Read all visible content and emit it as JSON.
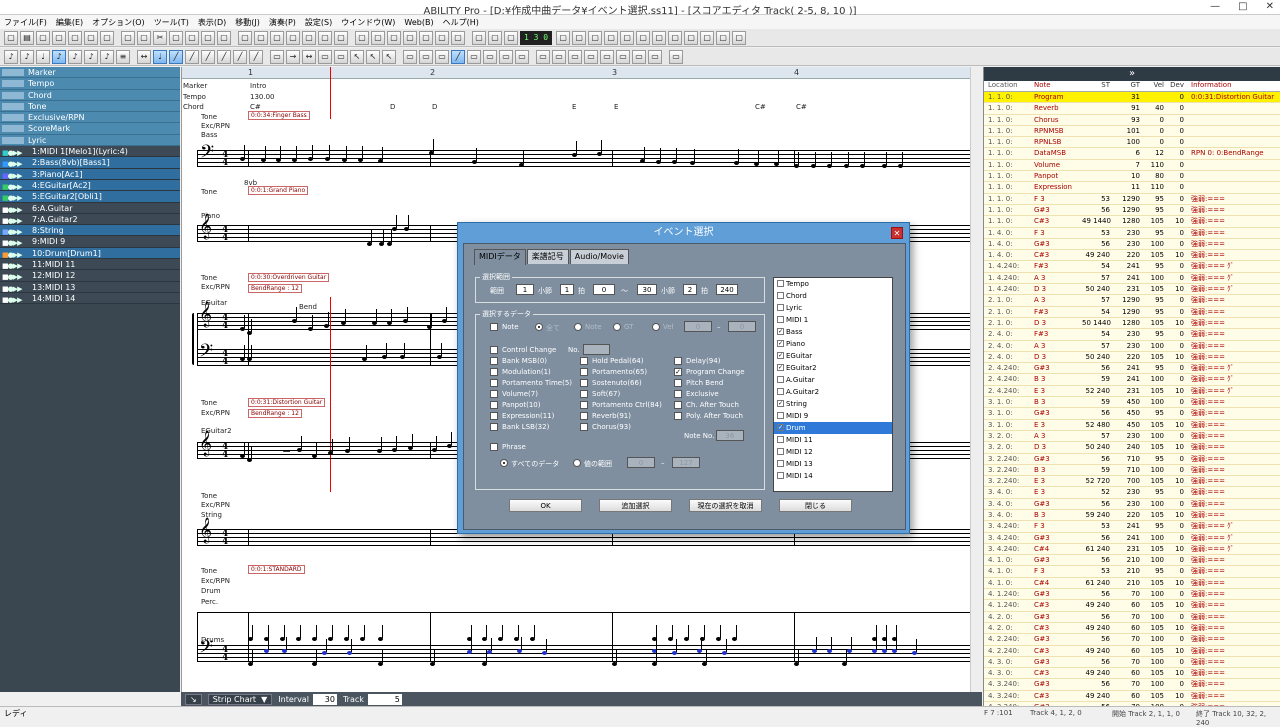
{
  "window": {
    "title": "ABILITY Pro - [D:¥作成中曲データ¥イベント選択.ss11] - [スコアエディタ Track( 2-5, 8, 10 )]",
    "minimize": "—",
    "maximize": "□",
    "close": "✕"
  },
  "menu": [
    "ファイル(F)",
    "編集(E)",
    "オプション(O)",
    "ツール(T)",
    "表示(D)",
    "移動(J)",
    "演奏(P)",
    "設定(S)",
    "ウインドウ(W)",
    "Web(B)",
    "ヘルプ(H)"
  ],
  "toolbar": {
    "counter": "1 3 0"
  },
  "tracks": {
    "master": [
      "Marker",
      "Tempo",
      "Chord",
      "Tone",
      "Exclusive/RPN",
      "ScoreMark",
      "Lyric"
    ],
    "items": [
      {
        "label": "1:MIDI 1[Melo1](Lyric:4)",
        "sel": false
      },
      {
        "label": "2:Bass(8vb)[Bass1]",
        "sel": true
      },
      {
        "label": "3:Piano[Ac1]",
        "sel": true
      },
      {
        "label": "4:EGuitar[Ac2]",
        "sel": true
      },
      {
        "label": "5:EGuitar2[Obli1]",
        "sel": true
      },
      {
        "label": "6:A.Guitar",
        "sel": false
      },
      {
        "label": "7:A.Guitar2",
        "sel": false
      },
      {
        "label": "8:String",
        "sel": true
      },
      {
        "label": "9:MIDI 9",
        "sel": false
      },
      {
        "label": "10:Drum[Drum1]",
        "sel": true
      },
      {
        "label": "11:MIDI 11",
        "sel": false
      },
      {
        "label": "12:MIDI 12",
        "sel": false
      },
      {
        "label": "13:MIDI 13",
        "sel": false
      },
      {
        "label": "14:MIDI 14",
        "sel": false
      }
    ]
  },
  "score": {
    "ruler": [
      "1",
      "2",
      "3",
      "4"
    ],
    "header": {
      "marker": "Marker",
      "marker_val": "Intro",
      "tempo": "Tempo",
      "tempo_val": "130.00",
      "chord": "Chord",
      "chords": [
        "C#",
        "D",
        "D",
        "E",
        "E",
        "C#",
        "C#"
      ]
    },
    "labels": {
      "tone": "Tone",
      "exc": "Exc/RPN",
      "bass": "Bass",
      "piano": "Piano",
      "eguitar": "EGuitar",
      "eguitar2": "EGuitar2",
      "string": "String",
      "drum": "Drum",
      "perc": "Perc.",
      "drums": "Drums",
      "oct": "8vb",
      "bendlbl": "Bend"
    },
    "tones": {
      "bass": "0:0:34:Finger Bass",
      "piano": "0:0:1:Grand Piano",
      "eg": "0:0:30:Overdriven Guitar",
      "eg_bend": "BendRange : 12",
      "eg2": "0:0:31:Distortion Guitar",
      "eg2_bend": "BendRange : 12",
      "drum": "0:0:1:STANDARD"
    }
  },
  "bottombar": {
    "mode": "Strip Chart",
    "interval_label": "Interval",
    "interval": "30",
    "track_label": "Track",
    "track": "5"
  },
  "statusbar": {
    "ready": "レディ",
    "r1": "F 7 :101",
    "r2": "Track 4, 1, 2, 0",
    "r3": "開始 Track 2, 1, 1, 0",
    "r4": "終了 Track 10, 32, 2, 240"
  },
  "eventlist": {
    "header": "»",
    "cols": [
      "Location",
      "Note",
      "ST",
      "GT",
      "Vel",
      "Dev",
      "Information"
    ],
    "rows": [
      {
        "loc": "1. 1. 0:",
        "note": "Program",
        "st": "",
        "gt": "31",
        "vel": "",
        "dev": "0",
        "info": "0:0:31:Distortion Guitar",
        "hl": true
      },
      {
        "loc": "1. 1. 0:",
        "note": "Reverb",
        "st": "",
        "gt": "91",
        "vel": "40",
        "dev": "0",
        "info": ""
      },
      {
        "loc": "1. 1. 0:",
        "note": "Chorus",
        "st": "",
        "gt": "93",
        "vel": "0",
        "dev": "0",
        "info": ""
      },
      {
        "loc": "1. 1. 0:",
        "note": "RPNMSB",
        "st": "",
        "gt": "101",
        "vel": "0",
        "dev": "0",
        "info": ""
      },
      {
        "loc": "1. 1. 0:",
        "note": "RPNLSB",
        "st": "",
        "gt": "100",
        "vel": "0",
        "dev": "0",
        "info": ""
      },
      {
        "loc": "1. 1. 0:",
        "note": "DataMSB",
        "st": "",
        "gt": "6",
        "vel": "12",
        "dev": "0",
        "info": "RPN 0: 0:BendRange"
      },
      {
        "loc": "1. 1. 0:",
        "note": "Volume",
        "st": "",
        "gt": "7",
        "vel": "110",
        "dev": "0",
        "info": ""
      },
      {
        "loc": "1. 1. 0:",
        "note": "Panpot",
        "st": "",
        "gt": "10",
        "vel": "80",
        "dev": "0",
        "info": ""
      },
      {
        "loc": "1. 1. 0:",
        "note": "Expression",
        "st": "",
        "gt": "11",
        "vel": "110",
        "dev": "0",
        "info": ""
      },
      {
        "loc": "1. 1. 0:",
        "note": "F 3",
        "st": "53",
        "gt": "1290",
        "vel": "95",
        "dev": "0",
        "info": "強弱:==="
      },
      {
        "loc": "1. 1. 0:",
        "note": "G#3",
        "st": "56",
        "gt": "1290",
        "vel": "95",
        "dev": "0",
        "info": "強弱:==="
      },
      {
        "loc": "1. 1. 0:",
        "note": "C#3",
        "st": "49 1440",
        "gt": "1280",
        "vel": "105",
        "dev": "10",
        "info": "強弱:==="
      },
      {
        "loc": "1. 4. 0:",
        "note": "F 3",
        "st": "53",
        "gt": "230",
        "vel": "95",
        "dev": "0",
        "info": "強弱:==="
      },
      {
        "loc": "1. 4. 0:",
        "note": "G#3",
        "st": "56",
        "gt": "230",
        "vel": "100",
        "dev": "0",
        "info": "強弱:==="
      },
      {
        "loc": "1. 4. 0:",
        "note": "C#3",
        "st": "49 240",
        "gt": "220",
        "vel": "105",
        "dev": "10",
        "info": "強弱:==="
      },
      {
        "loc": "1. 4.240:",
        "note": "F#3",
        "st": "54",
        "gt": "241",
        "vel": "95",
        "dev": "0",
        "info": "強弱:=== ｸﾞ"
      },
      {
        "loc": "1. 4.240:",
        "note": "A 3",
        "st": "57",
        "gt": "241",
        "vel": "100",
        "dev": "0",
        "info": "強弱:=== ｸﾞ"
      },
      {
        "loc": "1. 4.240:",
        "note": "D 3",
        "st": "50 240",
        "gt": "231",
        "vel": "105",
        "dev": "10",
        "info": "強弱:=== ｸﾞ"
      },
      {
        "loc": "2. 1. 0:",
        "note": "A 3",
        "st": "57",
        "gt": "1290",
        "vel": "95",
        "dev": "0",
        "info": "強弱:==="
      },
      {
        "loc": "2. 1. 0:",
        "note": "F#3",
        "st": "54",
        "gt": "1290",
        "vel": "95",
        "dev": "0",
        "info": "強弱:==="
      },
      {
        "loc": "2. 1. 0:",
        "note": "D 3",
        "st": "50 1440",
        "gt": "1280",
        "vel": "105",
        "dev": "10",
        "info": "強弱:==="
      },
      {
        "loc": "2. 4. 0:",
        "note": "F#3",
        "st": "54",
        "gt": "230",
        "vel": "95",
        "dev": "0",
        "info": "強弱:==="
      },
      {
        "loc": "2. 4. 0:",
        "note": "A 3",
        "st": "57",
        "gt": "230",
        "vel": "100",
        "dev": "0",
        "info": "強弱:==="
      },
      {
        "loc": "2. 4. 0:",
        "note": "D 3",
        "st": "50 240",
        "gt": "220",
        "vel": "105",
        "dev": "10",
        "info": "強弱:==="
      },
      {
        "loc": "2. 4.240:",
        "note": "G#3",
        "st": "56",
        "gt": "241",
        "vel": "95",
        "dev": "0",
        "info": "強弱:=== ｸﾞ"
      },
      {
        "loc": "2. 4.240:",
        "note": "B 3",
        "st": "59",
        "gt": "241",
        "vel": "100",
        "dev": "0",
        "info": "強弱:=== ｸﾞ"
      },
      {
        "loc": "2. 4.240:",
        "note": "E 3",
        "st": "52 240",
        "gt": "231",
        "vel": "105",
        "dev": "10",
        "info": "強弱:=== ｸﾞ"
      },
      {
        "loc": "3. 1. 0:",
        "note": "B 3",
        "st": "59",
        "gt": "450",
        "vel": "100",
        "dev": "0",
        "info": "強弱:==="
      },
      {
        "loc": "3. 1. 0:",
        "note": "G#3",
        "st": "56",
        "gt": "450",
        "vel": "95",
        "dev": "0",
        "info": "強弱:==="
      },
      {
        "loc": "3. 1. 0:",
        "note": "E 3",
        "st": "52 480",
        "gt": "450",
        "vel": "105",
        "dev": "10",
        "info": "強弱:==="
      },
      {
        "loc": "3. 2. 0:",
        "note": "A 3",
        "st": "57",
        "gt": "230",
        "vel": "100",
        "dev": "0",
        "info": "強弱:==="
      },
      {
        "loc": "3. 2. 0:",
        "note": "D 3",
        "st": "50 240",
        "gt": "240",
        "vel": "105",
        "dev": "10",
        "info": "強弱:==="
      },
      {
        "loc": "3. 2.240:",
        "note": "G#3",
        "st": "56",
        "gt": "710",
        "vel": "95",
        "dev": "0",
        "info": "強弱:==="
      },
      {
        "loc": "3. 2.240:",
        "note": "B 3",
        "st": "59",
        "gt": "710",
        "vel": "100",
        "dev": "0",
        "info": "強弱:==="
      },
      {
        "loc": "3. 2.240:",
        "note": "E 3",
        "st": "52 720",
        "gt": "700",
        "vel": "105",
        "dev": "10",
        "info": "強弱:==="
      },
      {
        "loc": "3. 4. 0:",
        "note": "E 3",
        "st": "52",
        "gt": "230",
        "vel": "95",
        "dev": "0",
        "info": "強弱:==="
      },
      {
        "loc": "3. 4. 0:",
        "note": "G#3",
        "st": "56",
        "gt": "230",
        "vel": "100",
        "dev": "0",
        "info": "強弱:==="
      },
      {
        "loc": "3. 4. 0:",
        "note": "B 3",
        "st": "59 240",
        "gt": "220",
        "vel": "105",
        "dev": "10",
        "info": "強弱:==="
      },
      {
        "loc": "3. 4.240:",
        "note": "F 3",
        "st": "53",
        "gt": "241",
        "vel": "95",
        "dev": "0",
        "info": "強弱:=== ｸﾞ"
      },
      {
        "loc": "3. 4.240:",
        "note": "G#3",
        "st": "56",
        "gt": "241",
        "vel": "100",
        "dev": "0",
        "info": "強弱:=== ｸﾞ"
      },
      {
        "loc": "3. 4.240:",
        "note": "C#4",
        "st": "61 240",
        "gt": "231",
        "vel": "105",
        "dev": "10",
        "info": "強弱:=== ｸﾞ"
      },
      {
        "loc": "4. 1. 0:",
        "note": "G#3",
        "st": "56",
        "gt": "210",
        "vel": "100",
        "dev": "0",
        "info": "強弱:==="
      },
      {
        "loc": "4. 1. 0:",
        "note": "F 3",
        "st": "53",
        "gt": "210",
        "vel": "95",
        "dev": "0",
        "info": "強弱:==="
      },
      {
        "loc": "4. 1. 0:",
        "note": "C#4",
        "st": "61 240",
        "gt": "210",
        "vel": "105",
        "dev": "10",
        "info": "強弱:==="
      },
      {
        "loc": "4. 1.240:",
        "note": "G#3",
        "st": "56",
        "gt": "70",
        "vel": "100",
        "dev": "0",
        "info": "強弱:==="
      },
      {
        "loc": "4. 1.240:",
        "note": "C#3",
        "st": "49 240",
        "gt": "60",
        "vel": "105",
        "dev": "10",
        "info": "強弱:==="
      },
      {
        "loc": "4. 2. 0:",
        "note": "G#3",
        "st": "56",
        "gt": "70",
        "vel": "100",
        "dev": "0",
        "info": "強弱:==="
      },
      {
        "loc": "4. 2. 0:",
        "note": "C#3",
        "st": "49 240",
        "gt": "60",
        "vel": "105",
        "dev": "10",
        "info": "強弱:==="
      },
      {
        "loc": "4. 2.240:",
        "note": "G#3",
        "st": "56",
        "gt": "70",
        "vel": "100",
        "dev": "0",
        "info": "強弱:==="
      },
      {
        "loc": "4. 2.240:",
        "note": "C#3",
        "st": "49 240",
        "gt": "60",
        "vel": "105",
        "dev": "10",
        "info": "強弱:==="
      },
      {
        "loc": "4. 3. 0:",
        "note": "G#3",
        "st": "56",
        "gt": "70",
        "vel": "100",
        "dev": "0",
        "info": "強弱:==="
      },
      {
        "loc": "4. 3. 0:",
        "note": "C#3",
        "st": "49 240",
        "gt": "60",
        "vel": "105",
        "dev": "10",
        "info": "強弱:==="
      },
      {
        "loc": "4. 3.240:",
        "note": "G#3",
        "st": "56",
        "gt": "70",
        "vel": "100",
        "dev": "0",
        "info": "強弱:==="
      },
      {
        "loc": "4. 3.240:",
        "note": "C#3",
        "st": "49 240",
        "gt": "60",
        "vel": "105",
        "dev": "10",
        "info": "強弱:==="
      },
      {
        "loc": "4. 3.240:",
        "note": "G#3",
        "st": "56",
        "gt": "70",
        "vel": "100",
        "dev": "0",
        "info": "強弱:==="
      }
    ]
  },
  "dialog": {
    "title": "イベント選択",
    "close": "✕",
    "tabs": [
      "MIDIデータ",
      "楽譜記号",
      "Audio/Movie"
    ],
    "range": {
      "group": "選択範囲",
      "label": "範囲",
      "from_bar": "1",
      "bar_lbl": "小節",
      "from_beat": "1",
      "beat_lbl": "拍",
      "from_tick": "0",
      "dash": "〜",
      "to_bar": "30",
      "to_beat": "2",
      "to_tick": "240"
    },
    "data": {
      "group": "選択するデータ",
      "note": "Note",
      "all": "全て",
      "note2": "Note",
      "gt": "GT",
      "vel": "Vel",
      "v1": "0",
      "v2": "0",
      "cc": "Control Change",
      "no": "No."
    },
    "checks": [
      {
        "label": "Bank MSB(0)",
        "checked": false
      },
      {
        "label": "Modulation(1)",
        "checked": false
      },
      {
        "label": "Portamento Time(5)",
        "checked": false
      },
      {
        "label": "Volume(7)",
        "checked": false
      },
      {
        "label": "Panpot(10)",
        "checked": false
      },
      {
        "label": "Expression(11)",
        "checked": false
      },
      {
        "label": "Bank LSB(32)",
        "checked": false
      },
      {
        "label": "Hold Pedal(64)",
        "checked": false
      },
      {
        "label": "Portamento(65)",
        "checked": false
      },
      {
        "label": "Sostenuto(66)",
        "checked": false
      },
      {
        "label": "Soft(67)",
        "checked": false
      },
      {
        "label": "Portamento Ctrl(84)",
        "checked": false
      },
      {
        "label": "Reverb(91)",
        "checked": false
      },
      {
        "label": "Chorus(93)",
        "checked": false
      },
      {
        "label": "Delay(94)",
        "checked": false
      },
      {
        "label": "Program Change",
        "checked": true
      },
      {
        "label": "Pitch Bend",
        "checked": false
      },
      {
        "label": "Exclusive",
        "checked": false
      },
      {
        "label": "Ch. After Touch",
        "checked": false
      },
      {
        "label": "Poly. After Touch",
        "checked": false
      }
    ],
    "noteno": "Note No.",
    "noteno_val": "36",
    "phrase": "Phrase",
    "alldata": "すべてのデータ",
    "valrange": "値の範囲",
    "vr1": "0",
    "vr2": "127",
    "tracklist": [
      {
        "label": "Tempo",
        "checked": false
      },
      {
        "label": "Chord",
        "checked": false
      },
      {
        "label": "Lyric",
        "checked": false
      },
      {
        "label": "MIDI 1",
        "checked": false
      },
      {
        "label": "Bass",
        "checked": true
      },
      {
        "label": "Piano",
        "checked": true
      },
      {
        "label": "EGuitar",
        "checked": true
      },
      {
        "label": "EGuitar2",
        "checked": true
      },
      {
        "label": "A.Guitar",
        "checked": false
      },
      {
        "label": "A.Guitar2",
        "checked": false
      },
      {
        "label": "String",
        "checked": true
      },
      {
        "label": "MIDI 9",
        "checked": false
      },
      {
        "label": "Drum",
        "checked": true,
        "sel": true
      },
      {
        "label": "MIDI 11",
        "checked": false
      },
      {
        "label": "MIDI 12",
        "checked": false
      },
      {
        "label": "MIDI 13",
        "checked": false
      },
      {
        "label": "MIDI 14",
        "checked": false
      }
    ],
    "buttons": {
      "ok": "OK",
      "add": "追加選択",
      "cancelsel": "現在の選択を取消",
      "close": "閉じる"
    }
  }
}
